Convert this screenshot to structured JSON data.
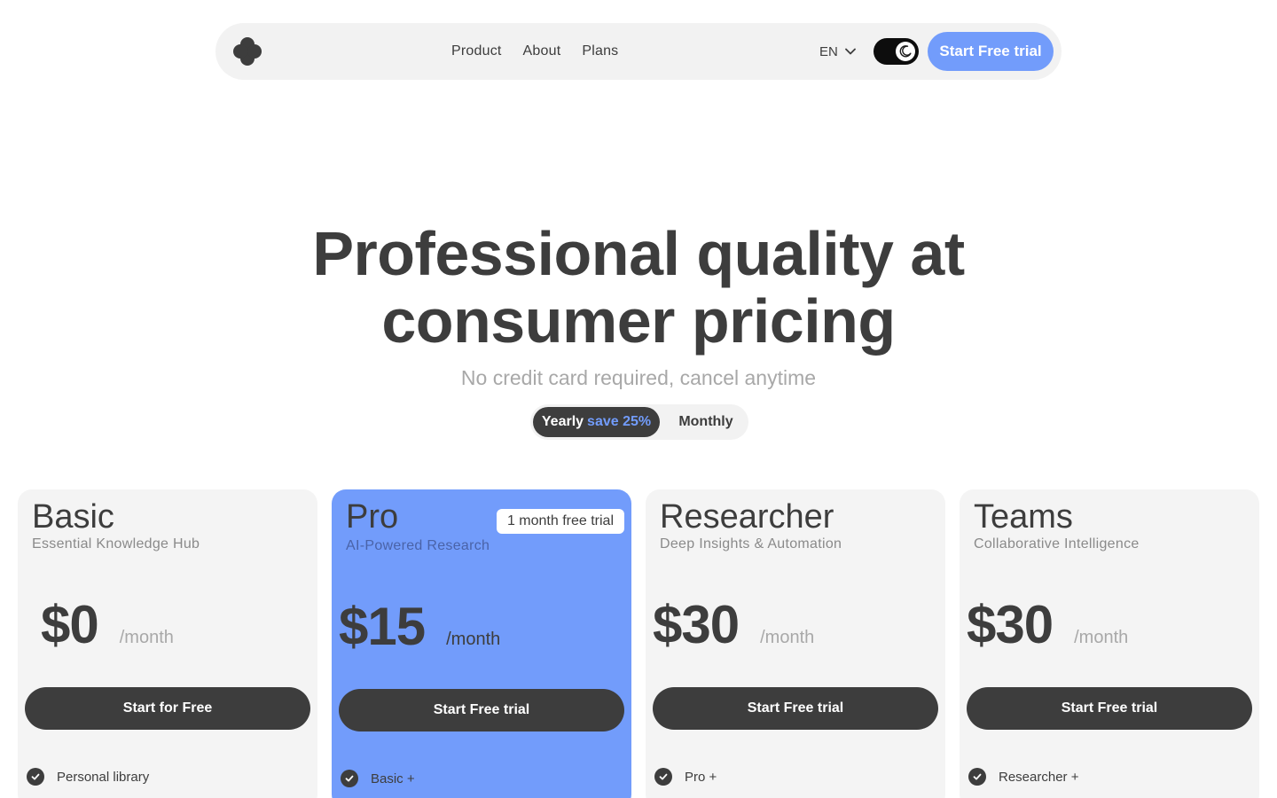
{
  "nav": {
    "links": [
      "Product",
      "About",
      "Plans"
    ],
    "language": "EN",
    "cta": "Start Free trial"
  },
  "hero": {
    "title_line1": "Professional quality at",
    "title_line2": "consumer pricing",
    "subtitle": "No credit card required, cancel anytime"
  },
  "billing": {
    "yearly": "Yearly",
    "save": "save 25%",
    "monthly": "Monthly"
  },
  "plans": [
    {
      "name": "Basic",
      "tagline": "Essential Knowledge Hub",
      "price": "$0",
      "unit": "/month",
      "cta": "Start for Free",
      "feature": "Personal library"
    },
    {
      "name": "Pro",
      "tagline": "AI-Powered Research",
      "badge": "1 month free trial",
      "price": "$15",
      "unit": "/month",
      "cta": "Start Free trial",
      "feature": "Basic +"
    },
    {
      "name": "Researcher",
      "tagline": "Deep Insights & Automation",
      "price": "$30",
      "unit": "/month",
      "cta": "Start Free trial",
      "feature": "Pro +"
    },
    {
      "name": "Teams",
      "tagline": "Collaborative Intelligence",
      "price": "$30",
      "unit": "/month",
      "cta": "Start Free trial",
      "feature": "Researcher +"
    }
  ],
  "colors": {
    "accent": "#729cfb",
    "dark": "#3d3d3d",
    "card_bg": "#f4f4f4"
  }
}
